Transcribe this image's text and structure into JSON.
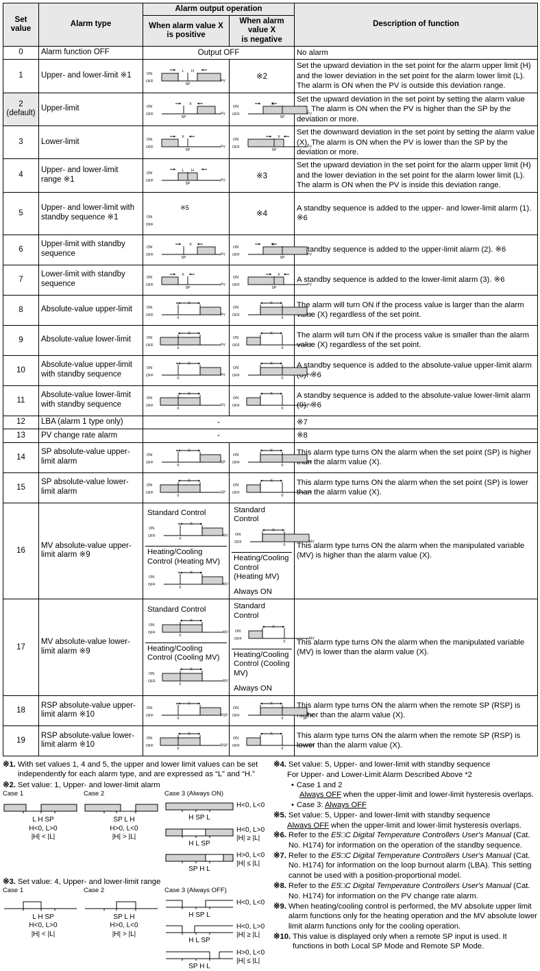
{
  "table": {
    "headers": {
      "set_value": "Set\nvalue",
      "alarm_type": "Alarm type",
      "alarm_output_operation": "Alarm output operation",
      "when_positive": "When alarm value X\nis positive",
      "when_negative": "When alarm value X\nis negative",
      "description": "Description of function"
    },
    "rows": [
      {
        "set_value": "0",
        "alarm_type": "Alarm function OFF",
        "output_span": "Output OFF",
        "description": "No alarm"
      },
      {
        "set_value": "1",
        "alarm_type": "Upper- and lower-limit ※1",
        "pos_diagram": "upper-lower-limit-positive",
        "neg_note": "※2",
        "description": "Set the upward deviation in the set point for the alarm upper limit (H) and the lower deviation in the set point for the alarm lower limit (L). The alarm is ON when the PV is outside this deviation range."
      },
      {
        "set_value": "2\n(default)",
        "default": true,
        "alarm_type": "Upper-limit",
        "pos_diagram": "upper-limit-positive",
        "neg_diagram": "upper-limit-negative",
        "description": "Set the upward deviation in the set point by setting the alarm value (X). The alarm is ON when the PV is higher than the SP by the deviation or more."
      },
      {
        "set_value": "3",
        "alarm_type": "Lower-limit",
        "pos_diagram": "lower-limit-positive",
        "neg_diagram": "lower-limit-negative",
        "description": "Set the downward deviation in the set point by setting the alarm value (X). The alarm is ON when the PV is lower than the SP by the deviation or more."
      },
      {
        "set_value": "4",
        "alarm_type": "Upper- and lower-limit range ※1",
        "pos_diagram": "upper-lower-range-positive",
        "neg_note": "※3",
        "description": "Set the upward deviation in the set point for the alarm upper limit (H) and the lower deviation in the set point for the alarm lower limit (L). The alarm is ON when the PV is inside this deviation range."
      },
      {
        "set_value": "5",
        "alarm_type": "Upper- and lower-limit with standby sequence ※1",
        "pos_diagram": "upper-lower-standby-positive",
        "pos_note": "※5",
        "neg_note": "※4",
        "description": "A standby sequence is added to the upper- and lower-limit alarm (1). ※6"
      },
      {
        "set_value": "6",
        "alarm_type": "Upper-limit with standby sequence",
        "pos_diagram": "upper-limit-positive",
        "neg_diagram": "upper-limit-negative",
        "description": "A standby sequence is added to the upper-limit alarm (2). ※6"
      },
      {
        "set_value": "7",
        "alarm_type": "Lower-limit with standby sequence",
        "pos_diagram": "lower-limit-positive",
        "neg_diagram": "lower-limit-negative",
        "description": "A standby sequence is added to the lower-limit alarm (3). ※6"
      },
      {
        "set_value": "8",
        "alarm_type": "Absolute-value upper-limit",
        "pos_diagram": "abs-upper-positive",
        "neg_diagram": "abs-upper-negative",
        "description": "The alarm will turn ON if the process value is larger than the alarm value (X) regardless of the set point."
      },
      {
        "set_value": "9",
        "alarm_type": "Absolute-value lower-limit",
        "pos_diagram": "abs-lower-positive",
        "neg_diagram": "abs-lower-negative",
        "description": "The alarm will turn ON if the process value is smaller than the alarm value (X) regardless of the set point."
      },
      {
        "set_value": "10",
        "alarm_type": "Absolute-value upper-limit with standby sequence",
        "pos_diagram": "abs-upper-positive",
        "neg_diagram": "abs-upper-negative",
        "description": "A standby sequence is added to the absolute-value upper-limit alarm (8). ※6"
      },
      {
        "set_value": "11",
        "alarm_type": "Absolute-value lower-limit with standby sequence",
        "pos_diagram": "abs-lower-positive",
        "neg_diagram": "abs-lower-negative",
        "description": "A standby sequence is added to the absolute-value lower-limit alarm (9). ※6"
      },
      {
        "set_value": "12",
        "alarm_type": "LBA (alarm 1 type only)",
        "output_span": "-",
        "description": "※7"
      },
      {
        "set_value": "13",
        "alarm_type": "PV change rate alarm",
        "output_span": "-",
        "description": "※8"
      },
      {
        "set_value": "14",
        "alarm_type": "SP absolute-value upper-limit alarm",
        "pos_diagram": "sp-abs-upper-positive",
        "neg_diagram": "sp-abs-upper-negative",
        "description": "This alarm type turns ON the alarm when the set point (SP) is higher than the alarm value (X)."
      },
      {
        "set_value": "15",
        "alarm_type": "SP absolute-value lower-limit alarm",
        "pos_diagram": "sp-abs-lower-positive",
        "neg_diagram": "sp-abs-lower-negative",
        "description": "This alarm type turns ON the alarm when the set point (SP) is lower than the alarm value (X)."
      },
      {
        "set_value": "16",
        "alarm_type": "MV absolute-value upper-limit alarm ※9",
        "split": true,
        "pos_top_label": "Standard Control",
        "pos_bottom_label": "Heating/Cooling Control (Heating MV)",
        "neg_top_label": "Standard Control",
        "neg_bottom_label": "Heating/Cooling Control (Heating MV)",
        "neg_bottom_text": "Always ON",
        "description": "This alarm type turns ON the alarm when the manipulated variable (MV) is higher than the alarm value (X)."
      },
      {
        "set_value": "17",
        "alarm_type": "MV absolute-value lower-limit alarm ※9",
        "split": true,
        "pos_top_label": "Standard Control",
        "pos_bottom_label": "Heating/Cooling Control (Cooling MV)",
        "neg_top_label": "Standard Control",
        "neg_bottom_label": "Heating/Cooling Control (Cooling MV)",
        "neg_bottom_text": "Always ON",
        "description": "This alarm type turns ON the alarm when the manipulated variable (MV) is lower than the alarm value (X)."
      },
      {
        "set_value": "18",
        "alarm_type": "RSP absolute-value upper-limit alarm ※10",
        "pos_diagram": "rsp-abs-upper-positive",
        "neg_diagram": "rsp-abs-upper-negative",
        "description": "This alarm type turns ON the alarm when the remote SP (RSP) is higher than the alarm value (X)."
      },
      {
        "set_value": "19",
        "alarm_type": "RSP absolute-value lower-limit alarm ※10",
        "pos_diagram": "rsp-abs-lower-positive",
        "neg_diagram": "rsp-abs-lower-negative",
        "description": "This alarm type turns ON the alarm when the remote SP (RSP) is lower than the alarm value (X)."
      }
    ]
  },
  "diagram_labels": {
    "on": "ON",
    "off": "OFF",
    "sp": "SP",
    "pv": "PV",
    "mv": "MV",
    "rsp": "RSP",
    "zero": "0",
    "x": "X",
    "l": "L",
    "h": "H"
  },
  "notes_left": {
    "n1": {
      "num": "※1.",
      "text": "With set values 1, 4 and 5, the upper and lower limit values can be set  independently for each alarm type, and are expressed as “L” and “H.”"
    },
    "n2": {
      "num": "※2.",
      "text": "Set value: 1, Upper- and lower-limit alarm",
      "case1_label": "Case 1",
      "case2_label": "Case 2",
      "case3_label": "Case 3 (Always ON)",
      "case1_ticks": "L   H  SP",
      "case2_ticks": "SP L   H",
      "case3a_ticks": "H    SP    L",
      "case3b_ticks": "H    L SP",
      "case3c_ticks": "SP H    L",
      "case1_cond1": "H<0, L>0",
      "case1_cond2": "|H| < |L|",
      "case2_cond1": "H>0, L<0",
      "case2_cond2": "|H| > |L|",
      "case3a_cond": "H<0, L<0",
      "case3b_cond1": "H<0, L>0",
      "case3b_cond2": "|H| ≥ |L|",
      "case3c_cond1": "H>0, L<0",
      "case3c_cond2": "|H| ≤ |L|"
    },
    "n3": {
      "num": "※3.",
      "text": "Set value: 4, Upper- and lower-limit range",
      "case1_label": "Case 1",
      "case2_label": "Case 2",
      "case3_label": "Case 3 (Always OFF)",
      "case1_ticks": "L   H  SP",
      "case2_ticks": "SP L   H",
      "case3a_ticks": "H    SP    L",
      "case3b_ticks": "H    L SP",
      "case3c_ticks": "SP H    L",
      "case1_cond1": "H<0, L>0",
      "case1_cond2": "|H| < |L|",
      "case2_cond1": "H>0, L<0",
      "case2_cond2": "|H| > |L|",
      "case3a_cond": "H<0, L<0",
      "case3b_cond1": "H<0, L>0",
      "case3b_cond2": "|H| ≥ |L|",
      "case3c_cond1": "H>0, L<0",
      "case3c_cond2": "|H| ≤ |L|"
    }
  },
  "notes_right": {
    "n4": {
      "num": "※4.",
      "title": "Set value: 5, Upper- and lower-limit with standby sequence",
      "sub": "For Upper- and Lower-Limit Alarm Described Above *2",
      "b1": "Case 1 and 2",
      "b1_sub_u": "Always OFF",
      "b1_sub_rest": " when the upper-limit and lower-limit hysteresis overlaps.",
      "b2_pre": "Case 3: ",
      "b2_u": "Always OFF"
    },
    "n5": {
      "num": "※5.",
      "title": "Set value: 5, Upper- and lower-limit with standby sequence",
      "line_u": "Always OFF",
      "line_rest": " when the upper-limit and lower-limit hysteresis overlaps."
    },
    "n6": {
      "num": "※6.",
      "pre": "Refer to the ",
      "ital": "E5□C Digital Temperature Controllers User's Manual",
      "post": " (Cat. No. H174) for information on the operation of the standby sequence."
    },
    "n7": {
      "num": "※7.",
      "pre": "Refer to the ",
      "ital": "E5□C Digital Temperature Controllers User's Manual",
      "post": " (Cat. No. H174) for information on the loop burnout alarm (LBA). This setting cannot be used with a position-proportional model."
    },
    "n8": {
      "num": "※8.",
      "pre": "Refer to the ",
      "ital": "E5□C Digital Temperature Controllers User's Manual",
      "post": " (Cat. No. H174) for information on the PV change rate alarm."
    },
    "n9": {
      "num": "※9.",
      "text": "When heating/cooling control is performed, the MV absolute upper limit alarm functions only for the heating operation and the MV absolute lower limit alarm functions only for the cooling operation."
    },
    "n10": {
      "num": "※10.",
      "text": "This value is displayed only when a remote SP input is used. It functions in both Local SP Mode and Remote SP Mode."
    }
  },
  "colors": {
    "header_bg": "#e8e8e8",
    "fill_gray": "#d2d2d2",
    "border": "#000000"
  }
}
